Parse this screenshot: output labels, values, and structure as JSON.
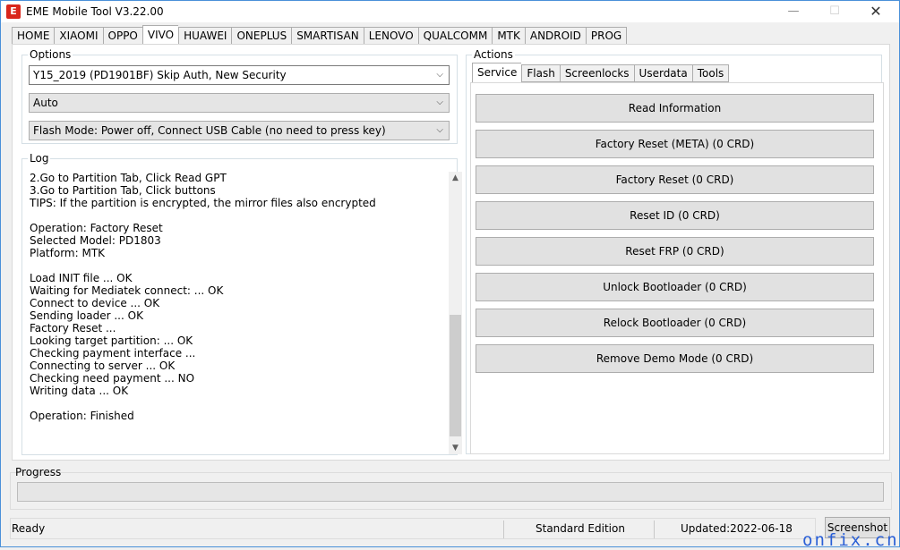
{
  "window": {
    "title": "EME Mobile Tool V3.22.00",
    "icon_letter": "E",
    "controls": [
      "—",
      "☐",
      "✕"
    ]
  },
  "top_tabs": [
    {
      "label": "HOME"
    },
    {
      "label": "XIAOMI"
    },
    {
      "label": "OPPO"
    },
    {
      "label": "VIVO",
      "active": true
    },
    {
      "label": "HUAWEI"
    },
    {
      "label": "ONEPLUS"
    },
    {
      "label": "SMARTISAN"
    },
    {
      "label": "LENOVO"
    },
    {
      "label": "QUALCOMM"
    },
    {
      "label": "MTK"
    },
    {
      "label": "ANDROID"
    },
    {
      "label": "PROG"
    }
  ],
  "options": {
    "legend": "Options",
    "model_select": "Y15_2019 (PD1901BF) Skip Auth, New Security",
    "mode_select": "Auto",
    "flash_mode_select": "Flash Mode: Power off, Connect USB Cable (no need to press key)"
  },
  "log": {
    "legend": "Log",
    "lines": [
      "2.Go to Partition Tab, Click Read GPT",
      "3.Go to Partition Tab, Click buttons",
      "TIPS: If the partition is encrypted, the mirror files also encrypted",
      "",
      "Operation: Factory Reset",
      "Selected Model: PD1803",
      "Platform: MTK",
      "",
      "Load INIT file ... OK",
      "Waiting for Mediatek connect: ... OK",
      "Connect to device ... OK",
      "Sending loader ... OK",
      "Factory Reset ...",
      "Looking target partition: ... OK",
      "Checking payment interface ...",
      "Connecting to server ... OK",
      "Checking need payment ... NO",
      "Writing data ... OK",
      "",
      "Operation: Finished"
    ]
  },
  "actions": {
    "legend": "Actions",
    "tabs": [
      {
        "label": "Service",
        "active": true
      },
      {
        "label": "Flash"
      },
      {
        "label": "Screenlocks"
      },
      {
        "label": "Userdata"
      },
      {
        "label": "Tools"
      }
    ],
    "buttons": [
      "Read Information",
      "Factory Reset (META) (0 CRD)",
      "Factory Reset (0 CRD)",
      "Reset ID (0 CRD)",
      "Reset FRP (0 CRD)",
      "Unlock Bootloader (0 CRD)",
      "Relock Bootloader (0 CRD)",
      "Remove Demo Mode (0 CRD)"
    ]
  },
  "progress": {
    "legend": "Progress",
    "value": 0
  },
  "status": {
    "state": "Ready",
    "edition": "Standard Edition",
    "updated": "Updated:2022-06-18",
    "screenshot_label": "Screenshot"
  },
  "watermark": "onfix.cn",
  "colors": {
    "accent_border": "#4a90d9",
    "icon_red": "#d9261c",
    "watermark": "#2a5fd6"
  }
}
